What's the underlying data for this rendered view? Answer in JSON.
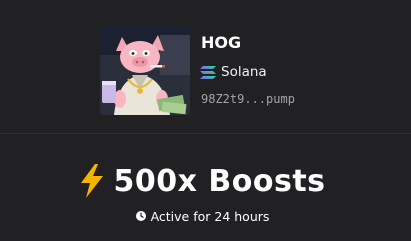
{
  "token": {
    "name": "HOG",
    "chain": "Solana",
    "address": "98Z2t9...pump",
    "image": "pig-meme-avatar"
  },
  "boost": {
    "title": "500x Boosts",
    "icon": "lightning-bolt-icon",
    "duration": "Active for 24 hours",
    "duration_icon": "clock-icon"
  },
  "colors": {
    "background": "#212124",
    "bolt": "#f5b400",
    "address": "#a4a4a8"
  }
}
